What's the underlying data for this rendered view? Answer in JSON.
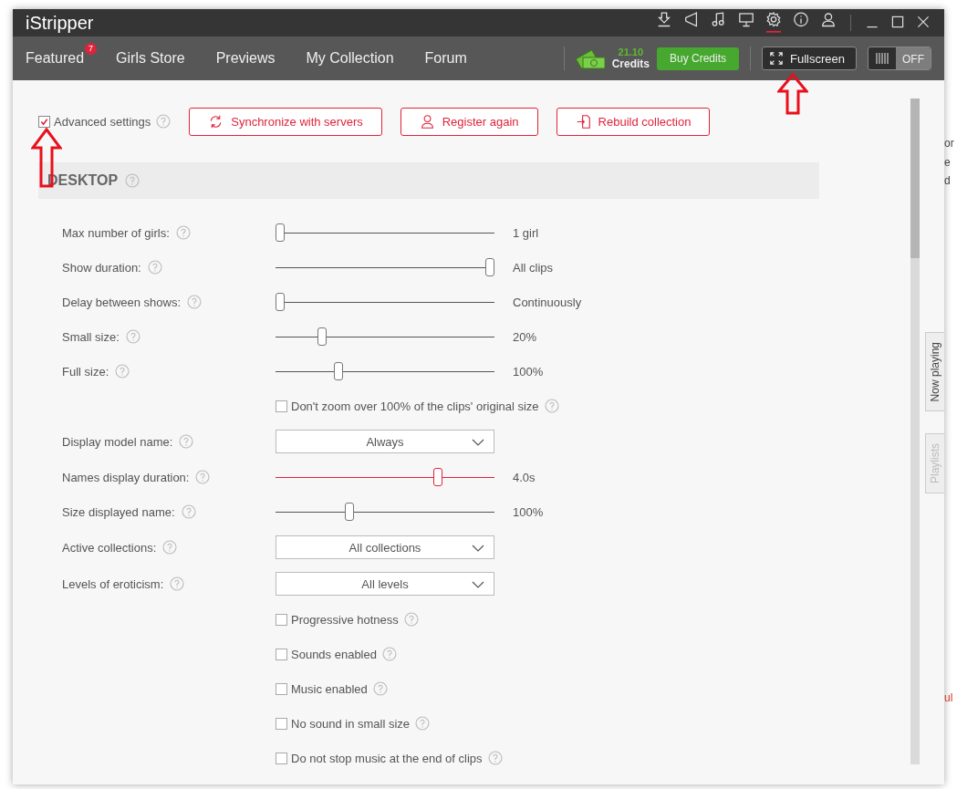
{
  "window": {
    "logo": "iStripper"
  },
  "toolbar": [
    {
      "kind": "download",
      "selected": false
    },
    {
      "kind": "megaphone",
      "selected": false
    },
    {
      "kind": "music",
      "selected": false
    },
    {
      "kind": "monitor",
      "selected": false
    },
    {
      "kind": "gear",
      "selected": true
    },
    {
      "kind": "info",
      "selected": false
    },
    {
      "kind": "user",
      "selected": false
    }
  ],
  "nav": {
    "tabs": [
      {
        "label": "Featured",
        "badge": "7"
      },
      {
        "label": "Girls Store"
      },
      {
        "label": "Previews"
      },
      {
        "label": "My Collection"
      },
      {
        "label": "Forum"
      }
    ],
    "credits": {
      "amount": "21.10",
      "label": "Credits"
    },
    "buy_button": "Buy Credits",
    "fullscreen_button": "Fullscreen",
    "toggle": {
      "label": "OFF",
      "on": false
    }
  },
  "settings": {
    "advanced": {
      "label": "Advanced settings",
      "checked": true
    },
    "actions": [
      {
        "kind": "sync",
        "label": "Synchronize with servers"
      },
      {
        "kind": "user",
        "label": "Register again"
      },
      {
        "kind": "rebuild",
        "label": "Rebuild collection"
      }
    ],
    "section": {
      "title": "DESKTOP"
    },
    "rows": [
      {
        "kind": "slider",
        "label": "Max number of girls:",
        "level": 0,
        "reading": "1 girl",
        "active": false
      },
      {
        "kind": "slider",
        "label": "Show duration:",
        "level": 1,
        "reading": "All clips",
        "active": false
      },
      {
        "kind": "slider",
        "label": "Delay between shows:",
        "level": 0,
        "reading": "Continuously",
        "active": false
      },
      {
        "kind": "slider",
        "label": "Small size:",
        "level": 0.2,
        "reading": "20%",
        "active": false
      },
      {
        "kind": "slider",
        "label": "Full size:",
        "level": 0.28,
        "reading": "100%",
        "active": false
      },
      {
        "kind": "checkbox",
        "label": "Don't zoom over 100% of the clips' original size",
        "checked": false
      },
      {
        "kind": "dropdown",
        "label": "Display model name:",
        "value": "Always"
      },
      {
        "kind": "slider",
        "label": "Names display duration:",
        "level": 0.75,
        "reading": "4.0s",
        "active": true
      },
      {
        "kind": "slider",
        "label": "Size displayed name:",
        "level": 0.33,
        "reading": "100%",
        "active": false
      },
      {
        "kind": "dropdown",
        "label": "Active collections:",
        "value": "All collections"
      },
      {
        "kind": "dropdown",
        "label": "Levels of eroticism:",
        "value": "All levels"
      },
      {
        "kind": "checkbox",
        "label": "Progressive hotness",
        "checked": false
      },
      {
        "kind": "checkbox",
        "label": "Sounds enabled",
        "checked": false
      },
      {
        "kind": "checkbox",
        "label": "Music enabled",
        "checked": false
      },
      {
        "kind": "checkbox",
        "label": "No sound in small size",
        "checked": false
      },
      {
        "kind": "checkbox",
        "label": "Do not stop music at the end of clips",
        "checked": false
      }
    ]
  },
  "side_tabs": [
    {
      "label": "Now playing",
      "selected": true
    },
    {
      "label": "Playlists",
      "selected": false
    }
  ],
  "background_page": {
    "fragments": [
      {
        "text": "or",
        "kind": "link"
      },
      {
        "text": "e",
        "kind": "link"
      },
      {
        "text": "d",
        "kind": "link"
      },
      {
        "text": "ul",
        "kind": "alert"
      }
    ]
  }
}
